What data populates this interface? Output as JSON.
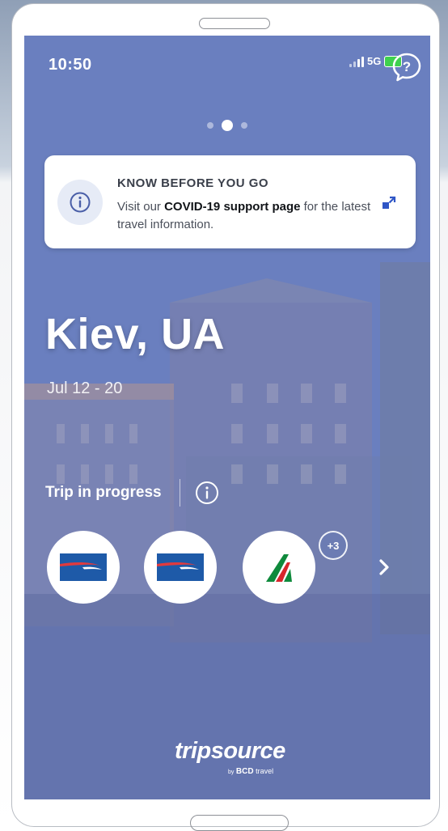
{
  "status_bar": {
    "time": "10:50",
    "network": "5G"
  },
  "carousel": {
    "pages": 3,
    "active_index": 1
  },
  "notice_card": {
    "title": "KNOW BEFORE YOU GO",
    "body_prefix": "Visit our ",
    "body_link": "COVID-19 support page",
    "body_suffix": " for the latest travel information.",
    "icon": "info-icon",
    "action_icon": "external-link-icon"
  },
  "trip": {
    "city": "Kiev, UA",
    "dates": "Jul 12 - 20",
    "status": "Trip in progress"
  },
  "bookings": [
    {
      "airline_logo": "british-airways-logo"
    },
    {
      "airline_logo": "british-airways-logo"
    },
    {
      "airline_logo": "alitalia-logo"
    }
  ],
  "more_bookings": "+3",
  "brand": {
    "name": "tripsource",
    "by": "by",
    "company": "BCD",
    "suffix": "travel"
  },
  "colors": {
    "screen_overlay": "#6b80bd",
    "british_airways_blue": "#1e5aa8",
    "british_airways_red": "#e03a3e",
    "alitalia_green": "#0f8a3c",
    "alitalia_red": "#d8262c",
    "battery_green": "#3fd14e"
  }
}
